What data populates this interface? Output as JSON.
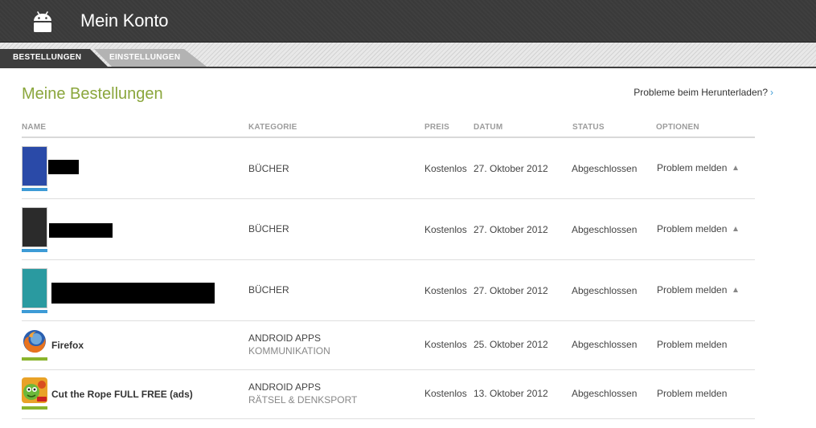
{
  "header": {
    "title": "Mein Konto",
    "logo_icon": "android-robot-icon"
  },
  "tabs": [
    {
      "label": "BESTELLUNGEN",
      "active": true
    },
    {
      "label": "EINSTELLUNGEN",
      "active": false
    }
  ],
  "main": {
    "title": "Meine Bestellungen",
    "help_link": "Probleme beim Herunterladen?",
    "help_link_chevron": "›"
  },
  "columns": {
    "name": "NAME",
    "category": "KATEGORIE",
    "price": "PREIS",
    "date": "DATUM",
    "status": "STATUS",
    "options": "OPTIONEN"
  },
  "orders": [
    {
      "name": "",
      "name_redacted": true,
      "category": "BÜCHER",
      "subcategory": "",
      "price": "Kostenlos",
      "date": "27. Oktober 2012",
      "status": "Abgeschlossen",
      "option": "Problem melden",
      "has_dropdown": true,
      "thumb": "book-cover",
      "cover_color": "#2a4aa8",
      "bar_color": "#3d9bd6"
    },
    {
      "name": "",
      "name_redacted": true,
      "category": "BÜCHER",
      "subcategory": "",
      "price": "Kostenlos",
      "date": "27. Oktober 2012",
      "status": "Abgeschlossen",
      "option": "Problem melden",
      "has_dropdown": true,
      "thumb": "book-cover",
      "cover_color": "#2b2b2b",
      "bar_color": "#3d9bd6"
    },
    {
      "name": "",
      "name_redacted": true,
      "category": "BÜCHER",
      "subcategory": "",
      "price": "Kostenlos",
      "date": "27. Oktober 2012",
      "status": "Abgeschlossen",
      "option": "Problem melden",
      "has_dropdown": true,
      "thumb": "book-cover",
      "cover_color": "#2a9aa0",
      "bar_color": "#3d9bd6"
    },
    {
      "name": "Firefox",
      "name_redacted": false,
      "category": "ANDROID APPS",
      "subcategory": "KOMMUNIKATION",
      "price": "Kostenlos",
      "date": "25. Oktober 2012",
      "status": "Abgeschlossen",
      "option": "Problem melden",
      "has_dropdown": false,
      "thumb": "firefox-icon",
      "bar_color": "#8ab42c"
    },
    {
      "name": "Cut the Rope FULL FREE (ads)",
      "name_redacted": false,
      "category": "ANDROID APPS",
      "subcategory": "RÄTSEL & DENKSPORT",
      "price": "Kostenlos",
      "date": "13. Oktober 2012",
      "status": "Abgeschlossen",
      "option": "Problem melden",
      "has_dropdown": false,
      "thumb": "cut-the-rope-icon",
      "bar_color": "#8ab42c"
    }
  ]
}
